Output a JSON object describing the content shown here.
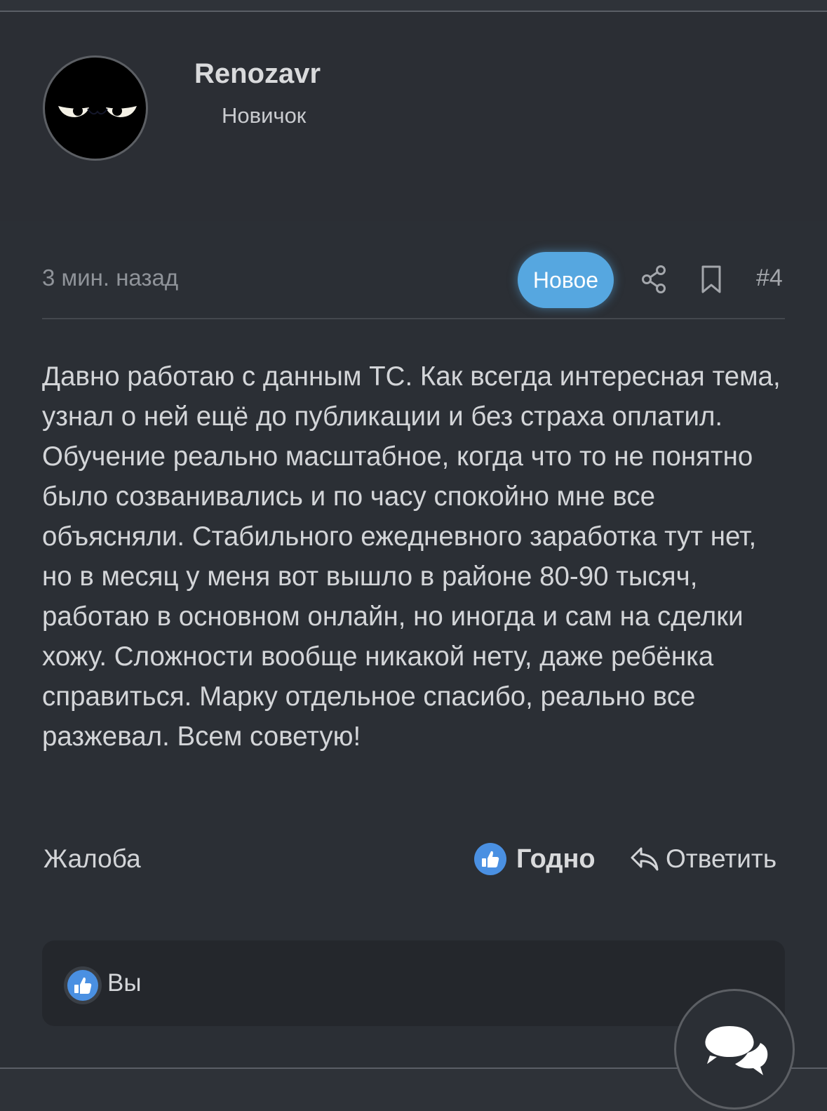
{
  "author": {
    "username": "Renozavr",
    "title": "Новичок"
  },
  "post": {
    "time": "3 мин. назад",
    "new_badge": "Новое",
    "number": "#4",
    "body": "Давно работаю с данным ТС. Как всегда интересная тема, узнал о ней ещё до публикации и без страха оплатил. Обучение реально масштабное, когда что то не понятно было созванивались и по часу спокойно мне все объясняли. Стабильного ежедневного заработка тут нет, но в месяц у меня вот вышло в районе 80-90 тысяч, работаю в основном онлайн, но иногда и сам на сделки хожу. Сложности вообще никакой нету, даже ребёнка справиться. Марку отдельное спасибо, реально все разжевал. Всем советую!"
  },
  "actions": {
    "report": "Жалоба",
    "like": "Годно",
    "reply": "Ответить"
  },
  "reactions": {
    "user": "Вы"
  },
  "icons": {
    "share": "share-icon",
    "bookmark": "bookmark-icon",
    "like": "thumbs-up-icon",
    "reply": "reply-arrow-icon",
    "chat": "chat-bubbles-icon"
  },
  "colors": {
    "background": "#2b2f35",
    "accent": "#56a7e0",
    "text": "#d3d5d8",
    "muted": "#8f9399"
  }
}
